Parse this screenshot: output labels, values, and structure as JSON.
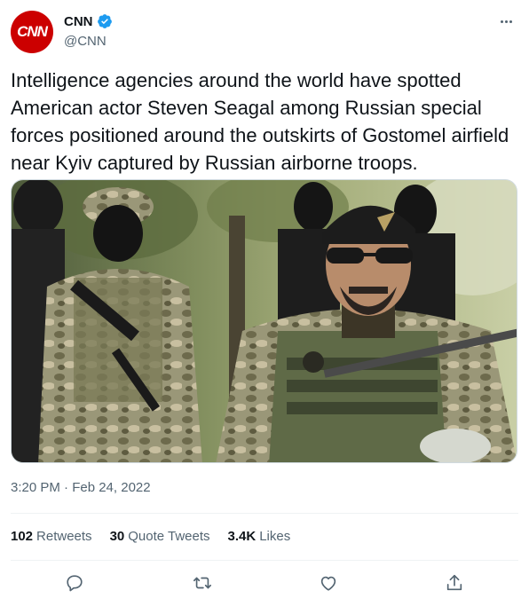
{
  "author": {
    "display_name": "CNN",
    "handle": "@CNN",
    "avatar_text": "CNN",
    "brand_color": "#cc0000",
    "verified_color": "#1d9bf0"
  },
  "tweet": {
    "text": "Intelligence agencies around the world have spotted American actor Steven Seagal among Russian special forces positioned around the outskirts of Gostomel airfield near Kyiv captured by Russian airborne troops.",
    "timestamp": "3:20 PM · Feb 24, 2022"
  },
  "stats": {
    "retweets_count": "102",
    "retweets_label": "Retweets",
    "quotes_count": "30",
    "quotes_label": "Quote Tweets",
    "likes_count": "3.4K",
    "likes_label": "Likes"
  },
  "actions": [
    "reply-icon",
    "retweet-icon",
    "like-icon",
    "share-icon"
  ],
  "colors": {
    "text": "#0f1419",
    "secondary": "#536471",
    "divider": "#eff3f4"
  }
}
